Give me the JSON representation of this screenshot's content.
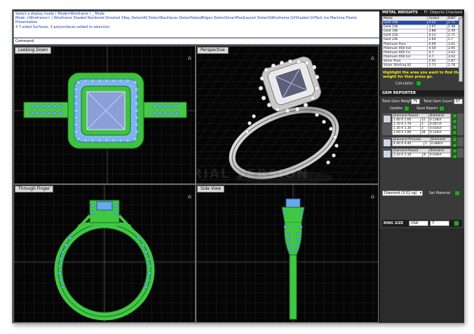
{
  "command_area": {
    "lines": [
      "Select a display mode ( Mode=Wireframe ) _ Mode",
      "Mode <Wireframe> ( Wireframe  Shaded  Rendered  Ghosted  XRay  DetectAll  DetectBackfaces  DetectNakedEdges  DetectSmartPixelLayout  DetectSWireframe  GVShaded  GVTech  Ice  Machine  Plastic  Presentation",
      "4 7-sided Surfaces, 3 polysurfaces added to selection."
    ],
    "prompt": "Command:"
  },
  "viewports": {
    "top_left": {
      "title": "Looking Down"
    },
    "top_right": {
      "title": "Perspective"
    },
    "bottom_left": {
      "title": "Through Finger"
    },
    "bottom_right": {
      "title": "Side View"
    }
  },
  "metal_weights": {
    "header": "METAL WEIGHTS",
    "subheader": "Fl. Objects Checked",
    "columns": [
      "Metal",
      "Grams",
      "DWT"
    ],
    "rows": [
      [
        "Gold 10k",
        "4.22",
        "2.71"
      ],
      [
        "Gold 14k",
        "3.97",
        "2.48"
      ],
      [
        "Gold 18k",
        "3.88",
        "2.49"
      ],
      [
        "Gold 22k",
        "4.21",
        "2.71"
      ],
      [
        "Gold 24k",
        "2.64",
        "1.7"
      ],
      [
        "Platinum Pure",
        "4.69",
        "3.01"
      ],
      [
        "Platinum 950 Ind",
        "4.59",
        "2.95"
      ],
      [
        "Platinum 950 Co",
        "4.7",
        "3.02"
      ],
      [
        "Platinum 950 Ird",
        "4.7",
        "3.02"
      ],
      [
        "Silver Pure",
        "2.92",
        "1.87"
      ],
      [
        "Silver Sterling 92",
        "2.73",
        "1.76"
      ]
    ],
    "selected_row": 0,
    "hint": "Highlight the area you want to find the weight for then press go.",
    "calculator_label": "Calculator"
  },
  "gem_reporter": {
    "header": "GEM REPORTER",
    "total_weight_label": "Total Gem Weight",
    "total_weight_value": "75",
    "total_count_label": "Total Gem Count",
    "total_count_value": "67",
    "update_label": "Update",
    "save_label": "Save Report",
    "groups": [
      {
        "shape": "Diamond Round",
        "cut": "Diamond",
        "rows": [
          [
            "1.60 X 1.60",
            "12",
            "0.138ct"
          ],
          [
            "1.70 X 1.70",
            "2",
            "0.047ct"
          ],
          [
            "1.30 X 1.30",
            "3",
            "0.034ct"
          ],
          [
            "1.00 X 1.00",
            "28",
            "0.120ct"
          ]
        ]
      },
      {
        "shape": "Diamond Princess",
        "cut": "Diamond",
        "rows": [
          [
            "4.40 X 4.40",
            "1",
            "0.486ct"
          ]
        ]
      },
      {
        "shape": "Diamond Round",
        "cut": "Diamond",
        "rows": [
          [
            "1.10 X 1.10",
            "8",
            "0.039ct"
          ]
        ]
      }
    ],
    "material_select": "Diamond (3.52 sg)",
    "set_material_label": "Set Material"
  },
  "ring_sizer": {
    "label": "RING SIZE",
    "country": "USA",
    "size": "7"
  },
  "colors": {
    "wire_green": "#3fd14a",
    "gem_blue": "#5aa0e6",
    "grid": "#3a3a3a"
  },
  "watermark": "TRIAL VERSION"
}
